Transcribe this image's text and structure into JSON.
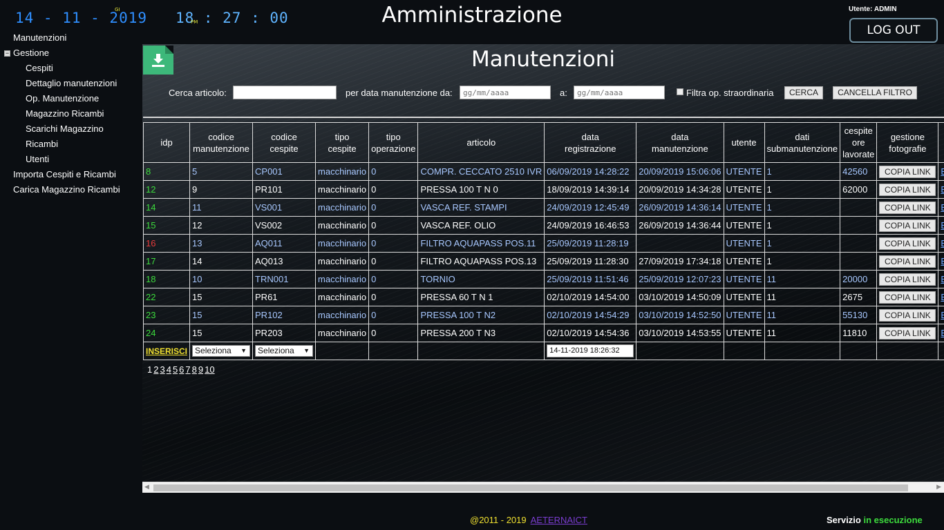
{
  "header": {
    "clock_date": "14 - 11 - 2019",
    "clock_time": "18 : 27 : 00",
    "clock_day": "GI",
    "clock_ampm": "PM",
    "title": "Amministrazione",
    "user_label": "Utente: ADMIN",
    "logout_label": "LOG OUT"
  },
  "sidebar": {
    "items": [
      {
        "label": "Manutenzioni"
      },
      {
        "label": "Gestione",
        "toggle": "−"
      },
      {
        "label": "Cespiti"
      },
      {
        "label": "Dettaglio manutenzioni"
      },
      {
        "label": "Op. Manutenzione"
      },
      {
        "label": "Magazzino Ricambi"
      },
      {
        "label": "Scarichi Magazzino"
      },
      {
        "label": "Ricambi"
      },
      {
        "label": "Utenti"
      },
      {
        "label": "Importa Cespiti e Ricambi"
      },
      {
        "label": "Carica Magazzino Ricambi"
      }
    ]
  },
  "main": {
    "page_title": "Manutenzioni",
    "filters": {
      "search_label": "Cerca articolo:",
      "search_value": "",
      "date_from_label": "per data manutenzione da:",
      "date_from_placeholder": "gg/mm/aaaa",
      "date_to_label": "a:",
      "date_to_placeholder": "gg/mm/aaaa",
      "straordinaria_label": "Filtra op. straordinaria",
      "search_button": "CERCA",
      "clear_button": "CANCELLA FILTRO"
    },
    "table": {
      "headers": {
        "idp": "idp",
        "codman1": "codice",
        "codman2": "manutenzione",
        "codcesp1": "codice",
        "codcesp2": "cespite",
        "tipoc1": "tipo",
        "tipoc2": "cespite",
        "tipoop1": "tipo",
        "tipoop2": "operazione",
        "art": "articolo",
        "datareg1": "data",
        "datareg2": "registrazione",
        "datam1": "data",
        "datam2": "manutenzione",
        "ut": "utente",
        "sub1": "dati",
        "sub2": "submanutenzione",
        "ore1": "cespite",
        "ore2": "ore",
        "ore3": "lavorate",
        "foto1": "gestione",
        "foto2": "fotografie"
      },
      "copy_label": "COPIA LINK",
      "extra_label": "EL",
      "rows": [
        {
          "idp": "8",
          "idp_color": "green",
          "codman": "5",
          "codcesp": "CP001",
          "tipoc": "macchinario",
          "tipoop": "0",
          "art": "COMPR. CECCATO 2510 IVR",
          "datareg": "06/09/2019 14:28:22",
          "datam": "20/09/2019 15:06:06",
          "ut": "UTENTE",
          "sub": "1",
          "ore": "42560"
        },
        {
          "idp": "12",
          "idp_color": "green",
          "codman": "9",
          "codcesp": "PR101",
          "tipoc": "macchinario",
          "tipoop": "0",
          "art": "PRESSA 100 T N 0",
          "datareg": "18/09/2019 14:39:14",
          "datam": "20/09/2019 14:34:28",
          "ut": "UTENTE",
          "sub": "1",
          "ore": "62000"
        },
        {
          "idp": "14",
          "idp_color": "green",
          "codman": "11",
          "codcesp": "VS001",
          "tipoc": "macchinario",
          "tipoop": "0",
          "art": "VASCA REF. STAMPI",
          "datareg": "24/09/2019 12:45:49",
          "datam": "26/09/2019 14:36:14",
          "ut": "UTENTE",
          "sub": "1",
          "ore": ""
        },
        {
          "idp": "15",
          "idp_color": "green",
          "codman": "12",
          "codcesp": "VS002",
          "tipoc": "macchinario",
          "tipoop": "0",
          "art": "VASCA REF. OLIO",
          "datareg": "24/09/2019 16:46:53",
          "datam": "26/09/2019 14:36:44",
          "ut": "UTENTE",
          "sub": "1",
          "ore": ""
        },
        {
          "idp": "16",
          "idp_color": "red",
          "codman": "13",
          "codcesp": "AQ011",
          "tipoc": "macchinario",
          "tipoop": "0",
          "art": "FILTRO AQUAPASS POS.11",
          "datareg": "25/09/2019 11:28:19",
          "datam": "",
          "ut": "UTENTE",
          "sub": "1",
          "ore": ""
        },
        {
          "idp": "17",
          "idp_color": "green",
          "codman": "14",
          "codcesp": "AQ013",
          "tipoc": "macchinario",
          "tipoop": "0",
          "art": "FILTRO AQUAPASS POS.13",
          "datareg": "25/09/2019 11:28:30",
          "datam": "27/09/2019 17:34:18",
          "ut": "UTENTE",
          "sub": "1",
          "ore": ""
        },
        {
          "idp": "18",
          "idp_color": "green",
          "codman": "10",
          "codcesp": "TRN001",
          "tipoc": "macchinario",
          "tipoop": "0",
          "art": "TORNIO",
          "datareg": "25/09/2019 11:51:46",
          "datam": "25/09/2019 12:07:23",
          "ut": "UTENTE",
          "sub": "11",
          "ore": "20000"
        },
        {
          "idp": "22",
          "idp_color": "green",
          "codman": "15",
          "codcesp": "PR61",
          "tipoc": "macchinario",
          "tipoop": "0",
          "art": "PRESSA 60 T N 1",
          "datareg": "02/10/2019 14:54:00",
          "datam": "03/10/2019 14:50:09",
          "ut": "UTENTE",
          "sub": "11",
          "ore": "2675"
        },
        {
          "idp": "23",
          "idp_color": "green",
          "codman": "15",
          "codcesp": "PR102",
          "tipoc": "macchinario",
          "tipoop": "0",
          "art": "PRESSA 100 T N2",
          "datareg": "02/10/2019 14:54:29",
          "datam": "03/10/2019 14:52:50",
          "ut": "UTENTE",
          "sub": "11",
          "ore": "55130"
        },
        {
          "idp": "24",
          "idp_color": "green",
          "codman": "15",
          "codcesp": "PR203",
          "tipoc": "macchinario",
          "tipoop": "0",
          "art": "PRESSA 200 T N3",
          "datareg": "02/10/2019 14:54:36",
          "datam": "03/10/2019 14:53:55",
          "ut": "UTENTE",
          "sub": "11",
          "ore": "11810"
        }
      ],
      "insert_row": {
        "insert_label": "INSERISCI",
        "select1": "Seleziona",
        "select2": "Seleziona",
        "date_value": "14-11-2019 18:26:32"
      }
    },
    "pagination": [
      "1",
      "2",
      "3",
      "4",
      "5",
      "6",
      "7",
      "8",
      "9",
      "10"
    ]
  },
  "footer": {
    "copyright": "@2011 - 2019",
    "company_link": "AETERNAICT",
    "status_label": "Servizio",
    "status_value": "in esecuzione"
  },
  "colors": {
    "accent_green": "#3ddc3d",
    "accent_red": "#e83b3b",
    "accent_yellow": "#f0e030",
    "clock_blue": "#2f8fff"
  }
}
